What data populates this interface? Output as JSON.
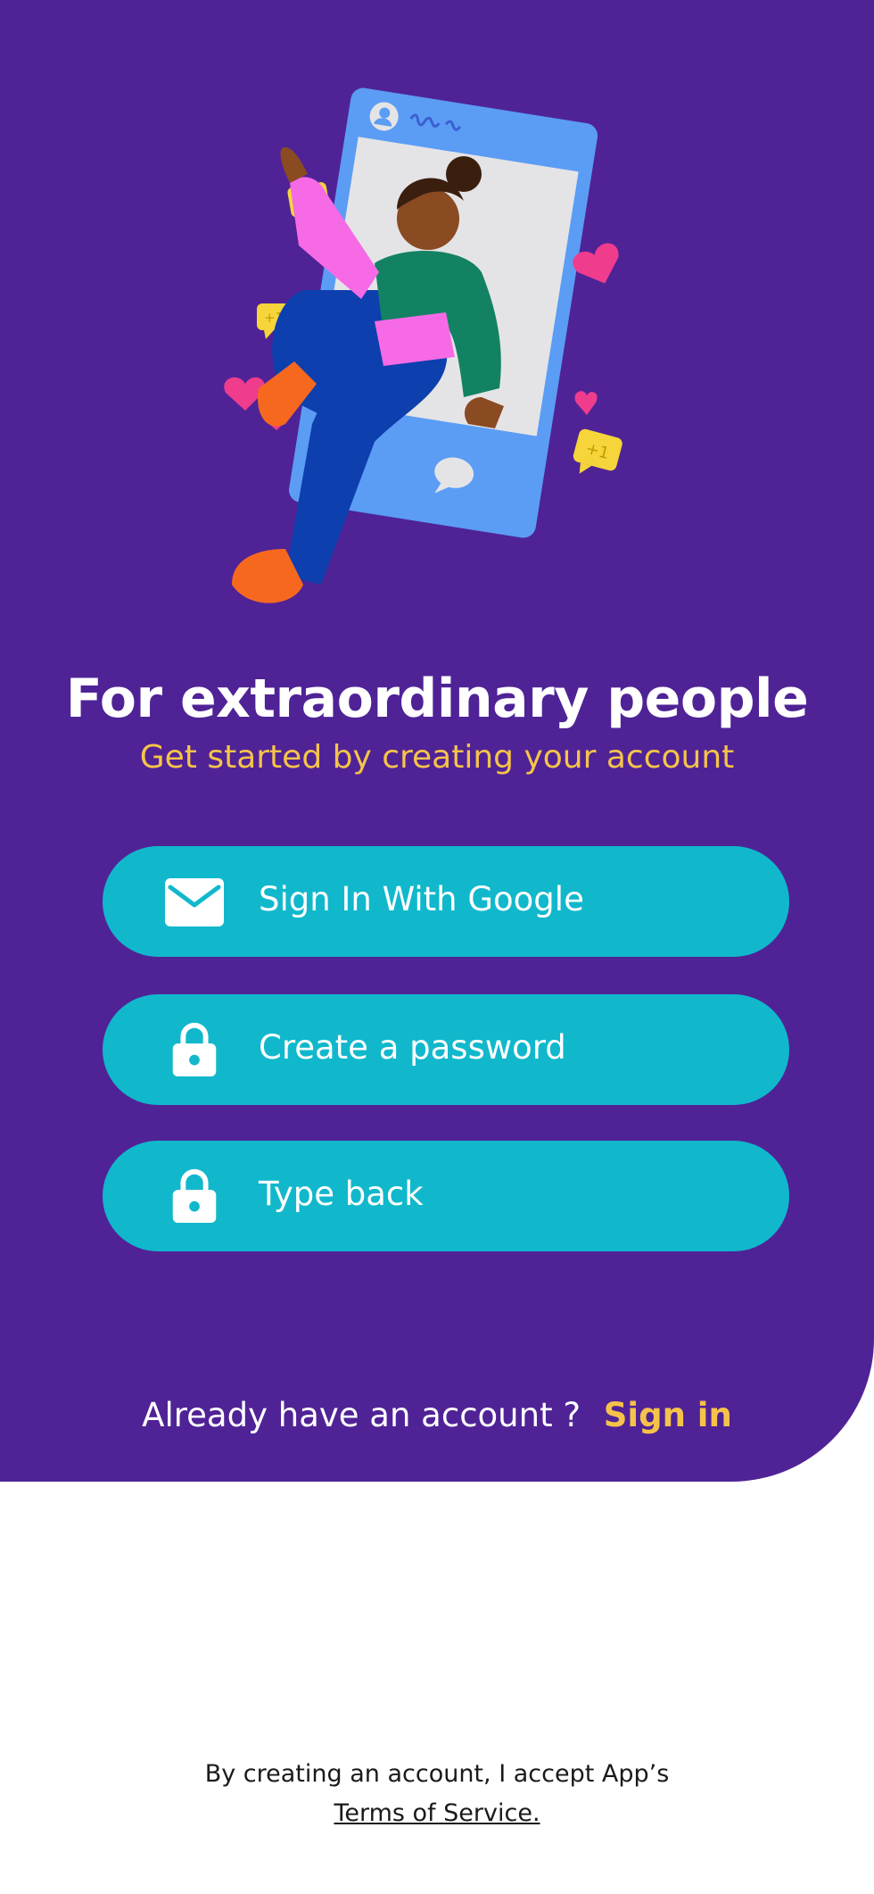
{
  "hero": {
    "title": "For extraordinary people",
    "subtitle": "Get started by creating your account"
  },
  "buttons": [
    {
      "label": "Sign In With Google",
      "icon": "envelope-icon"
    },
    {
      "label": "Create a password",
      "icon": "lock-icon"
    },
    {
      "label": "Type back",
      "icon": "lock-icon"
    }
  ],
  "account": {
    "prompt": "Already have an account ?",
    "signin_label": "Sign in"
  },
  "terms": {
    "line1": "By creating an account, I accept App’s",
    "link": "Terms of Service."
  },
  "illustration": {
    "badge": "+1"
  },
  "colors": {
    "background": "#4f2396",
    "accent": "#f6c34a",
    "button": "#11b8cc",
    "surface": "#ffffff"
  }
}
